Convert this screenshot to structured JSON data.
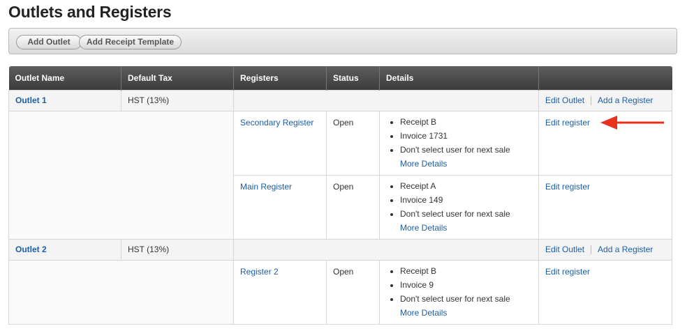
{
  "page": {
    "title": "Outlets and Registers"
  },
  "toolbar": {
    "add_outlet_label": "Add Outlet",
    "add_receipt_template_label": "Add Receipt Template"
  },
  "table": {
    "headers": [
      "Outlet Name",
      "Default Tax",
      "Registers",
      "Status",
      "Details",
      ""
    ],
    "outlets": [
      {
        "name": "Outlet 1",
        "tax": "HST (13%)",
        "edit_outlet": "Edit Outlet",
        "add_register": "Add a Register",
        "registers": [
          {
            "name": "Secondary Register",
            "status": "Open",
            "details": [
              "Receipt B",
              "Invoice 1731",
              "Don't select user for next sale"
            ],
            "more_details": "More Details",
            "edit": "Edit register"
          },
          {
            "name": "Main Register",
            "status": "Open",
            "details": [
              "Receipt A",
              "Invoice 149",
              "Don't select user for next sale"
            ],
            "more_details": "More Details",
            "edit": "Edit register"
          }
        ]
      },
      {
        "name": "Outlet 2",
        "tax": "HST (13%)",
        "edit_outlet": "Edit Outlet",
        "add_register": "Add a Register",
        "registers": [
          {
            "name": "Register 2",
            "status": "Open",
            "details": [
              "Receipt B",
              "Invoice 9",
              "Don't select user for next sale"
            ],
            "more_details": "More Details",
            "edit": "Edit register"
          }
        ]
      }
    ]
  },
  "annotation": {
    "arrow_color": "#e8321e",
    "arrow_icon": "left-arrow-icon"
  },
  "colors": {
    "link": "#1c5ea8",
    "header_bg": "#4a4a4a"
  }
}
